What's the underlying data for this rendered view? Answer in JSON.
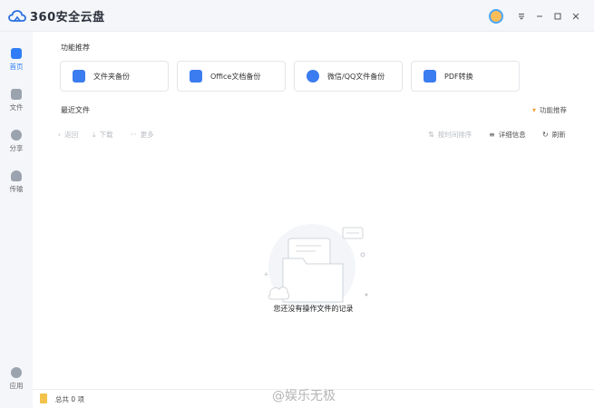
{
  "app": {
    "title": "360安全云盘"
  },
  "window_controls": [
    "avatar-icon",
    "menu-icon",
    "minimize-icon",
    "maximize-icon",
    "close-icon"
  ],
  "sidebar": {
    "items": [
      {
        "label": "首页",
        "icon": "home-icon",
        "active": true
      },
      {
        "label": "文件",
        "icon": "folder-icon",
        "active": false
      },
      {
        "label": "分享",
        "icon": "share-icon",
        "active": false
      },
      {
        "label": "传输",
        "icon": "transfer-icon",
        "active": false
      },
      {
        "label": "应用",
        "icon": "apps-icon",
        "active": false
      }
    ]
  },
  "features": {
    "title": "功能推荐",
    "items": [
      {
        "label": "文件夹备份",
        "icon": "folder-backup-icon",
        "color": "#3b7cf0"
      },
      {
        "label": "Office文档备份",
        "icon": "office-backup-icon",
        "color": "#3b7cf0"
      },
      {
        "label": "微信/QQ文件备份",
        "icon": "chat-backup-icon",
        "color": "#3b7cf0"
      },
      {
        "label": "PDF转换",
        "icon": "pdf-convert-icon",
        "color": "#3b7cf0"
      }
    ]
  },
  "recent": {
    "title": "最近文件",
    "feature_link": "功能推荐",
    "toolbar": {
      "back": "返回",
      "download": "下载",
      "more": "更多",
      "sort": "按时间排序",
      "details": "详细信息",
      "refresh": "刷新"
    },
    "empty_text": "您还没有操作文件的记录"
  },
  "status": {
    "count_text": "总共 0 项"
  },
  "watermark": "@娱乐无极",
  "colors": {
    "accent": "#2f7df6",
    "sidebar_bg": "#f4f6f9",
    "folder": "#f2c24a"
  }
}
